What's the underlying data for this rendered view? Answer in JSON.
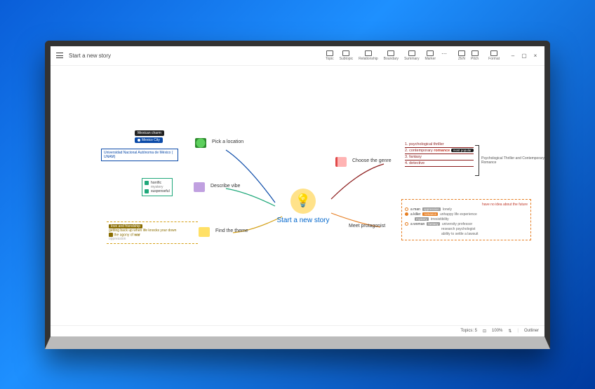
{
  "window": {
    "title": "Start a new story",
    "toolbar": {
      "items": [
        {
          "icon": "topic",
          "label": "Topic"
        },
        {
          "icon": "subtopic",
          "label": "Subtopic"
        },
        {
          "icon": "relationship",
          "label": "Relationship"
        },
        {
          "icon": "boundary",
          "label": "Boundary"
        },
        {
          "icon": "summary",
          "label": "Summary"
        },
        {
          "icon": "marker",
          "label": "Marker"
        },
        {
          "icon": "more",
          "label": "..."
        }
      ],
      "right_group": [
        {
          "icon": "zen",
          "label": "ZEN"
        },
        {
          "icon": "pitch",
          "label": "Pitch"
        }
      ],
      "format_label": "Format"
    },
    "controls": {
      "minimize": "–",
      "maximize": "▢",
      "close": "×"
    }
  },
  "center": {
    "title": "Start a new story",
    "idea_label": "Idea"
  },
  "branches": {
    "pick_location": {
      "label": "Pick a location",
      "tag": "Mexican charm",
      "city": "Mexico City",
      "detail": "Universidad Nacional Autónoma de México ( UNAM)"
    },
    "describe_vibe": {
      "label": "Describe vibe",
      "items": [
        "horrific",
        "mystery",
        "suspenseful"
      ]
    },
    "find_theme": {
      "label": "Find the theme",
      "tag": "love and friendship",
      "line1": "getting back up when life knocks your down",
      "line2_prefix": "the agony of",
      "line2_bold": "war",
      "sub": "oppression"
    },
    "choose_genre": {
      "label": "Choose the genre",
      "items": [
        {
          "n": "1.",
          "text": "psychological thriller"
        },
        {
          "n": "2.",
          "text": "contemporary",
          "bold": "romance",
          "tag": "most popular"
        },
        {
          "n": "3.",
          "text": "fantasy"
        },
        {
          "n": "4.",
          "text": "detective"
        }
      ],
      "summary": "Psychological Thriller and Contemporary Romance"
    },
    "meet_protagonist": {
      "label": "Meet protagonist",
      "note": "have no idea about the future",
      "people": [
        {
          "who": "a man",
          "tag": "oppression",
          "trait": "lonely",
          "selected": false
        },
        {
          "who": "a killer",
          "tag": "romance",
          "traits": [
            "unhappy life experience",
            "irresistibility"
          ],
          "selected": true,
          "sub": "mystery"
        },
        {
          "who": "a woman",
          "tag": "fantasy",
          "traits": [
            "university professor",
            "research psychologist",
            "ability to settle a lawsuit"
          ],
          "selected": false
        }
      ]
    }
  },
  "statusbar": {
    "topics": "Topics: 5",
    "zoom": "100%",
    "outliner": "Outliner"
  }
}
